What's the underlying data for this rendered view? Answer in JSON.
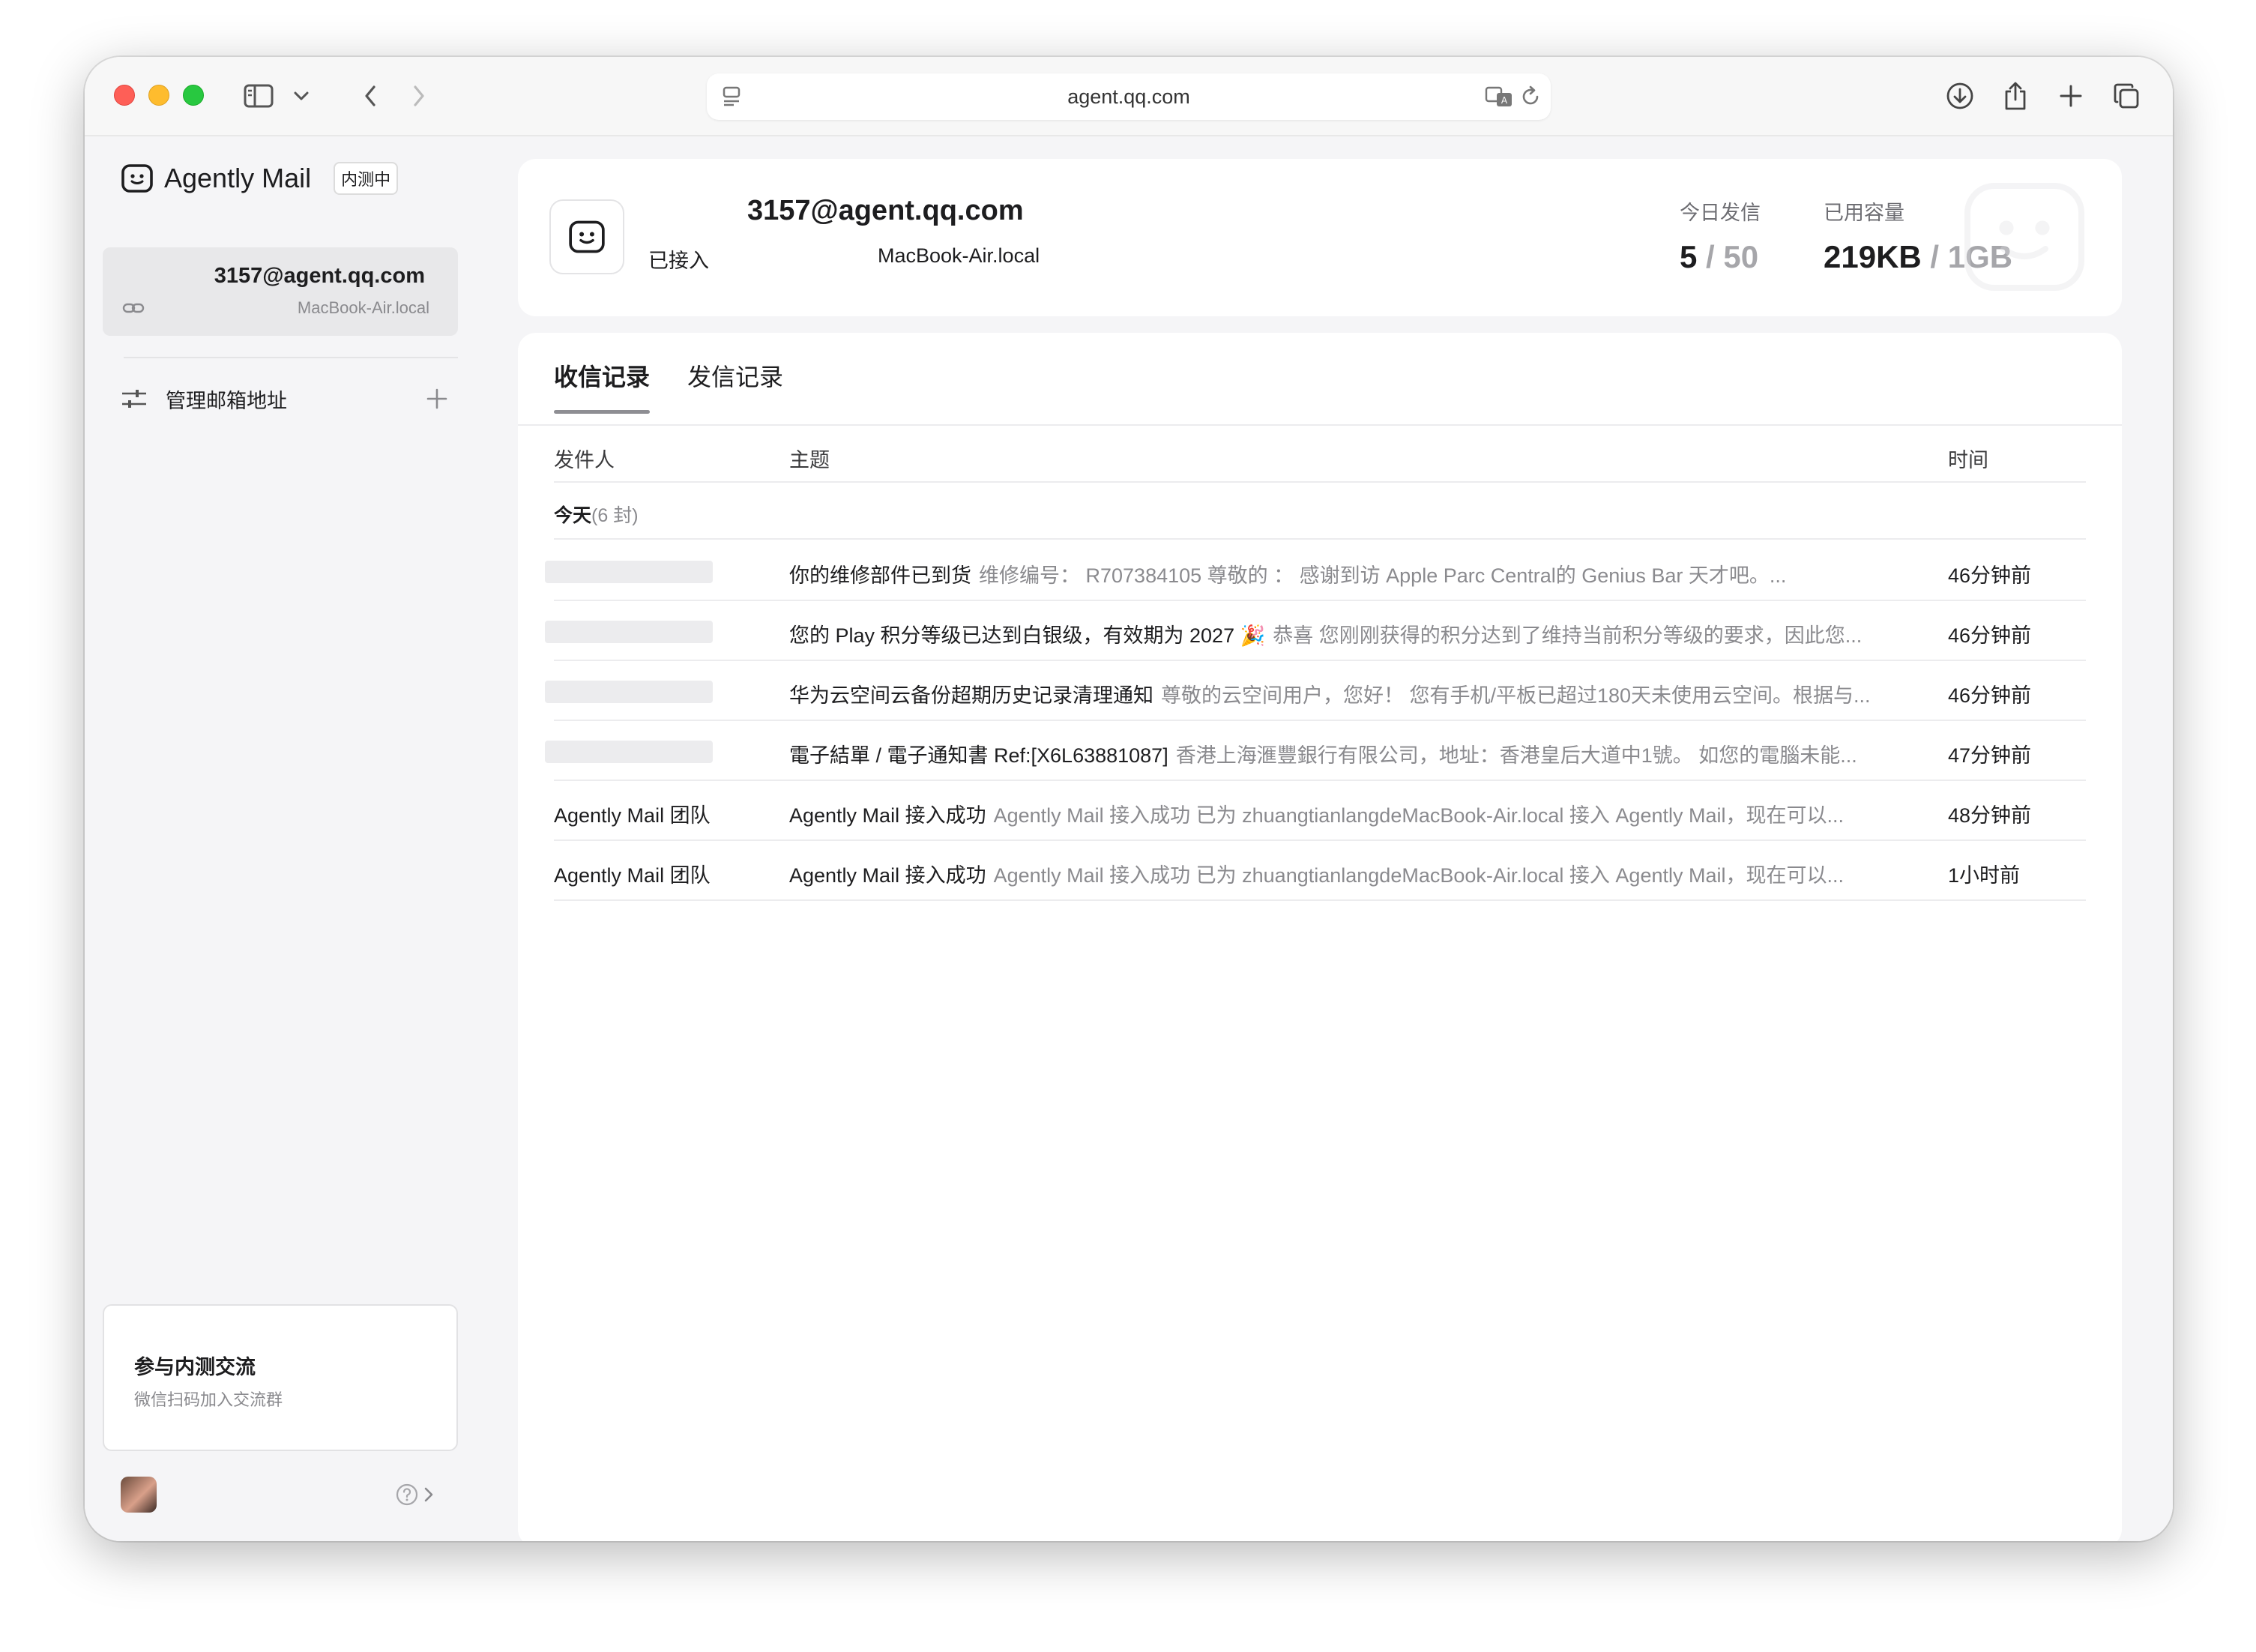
{
  "browser": {
    "url": "agent.qq.com"
  },
  "sidebar": {
    "brand": "Agently Mail",
    "beta_badge": "内测中",
    "mailbox_address": "3157@agent.qq.com",
    "mailbox_host": "MacBook-Air.local",
    "manage_label": "管理邮箱地址",
    "community_title": "参与内测交流",
    "community_subtitle": "微信扫码加入交流群"
  },
  "account": {
    "address": "3157@agent.qq.com",
    "status": "已接入",
    "host": "MacBook-Air.local",
    "sent_today_label": "今日发信",
    "sent_today_value": "5",
    "sent_today_limit": "/ 50",
    "storage_label": "已用容量",
    "storage_value": "219KB",
    "storage_limit": "/ 1GB"
  },
  "tabs": [
    {
      "label": "收信记录",
      "active": true
    },
    {
      "label": "发信记录",
      "active": false
    }
  ],
  "table": {
    "col_from": "发件人",
    "col_subject": "主题",
    "col_time": "时间",
    "group_label": "今天",
    "group_count": "(6 封)",
    "rows": [
      {
        "from": "",
        "subject": "你的维修部件已到货",
        "preview": "维修编号： R707384105 尊敬的 ：  感谢到访 Apple Parc Central的 Genius Bar 天才吧。...",
        "time": "46分钟前"
      },
      {
        "from": "",
        "subject": "您的 Play 积分等级已达到白银级，有效期为 2027 🎉",
        "preview": "恭喜 您刚刚获得的积分达到了维持当前积分等级的要求，因此您...",
        "time": "46分钟前"
      },
      {
        "from": "",
        "subject": "华为云空间云备份超期历史记录清理通知",
        "preview": "尊敬的云空间用户，您好！ 您有手机/平板已超过180天未使用云空间。根据与...",
        "time": "46分钟前"
      },
      {
        "from": "",
        "subject": "電子結單 / 電子通知書 Ref:[X6L63881087]",
        "preview": "香港上海滙豐銀行有限公司，地址：香港皇后大道中1號。 如您的電腦未能...",
        "time": "47分钟前"
      },
      {
        "from": "Agently Mail 团队",
        "subject": "Agently Mail 接入成功",
        "preview": "Agently Mail 接入成功 已为 zhuangtianlangdeMacBook-Air.local 接入 Agently Mail，现在可以...",
        "time": "48分钟前"
      },
      {
        "from": "Agently Mail 团队",
        "subject": "Agently Mail 接入成功",
        "preview": "Agently Mail 接入成功 已为 zhuangtianlangdeMacBook-Air.local 接入 Agently Mail，现在可以...",
        "time": "1小时前"
      }
    ]
  },
  "colors": {
    "accent": "#1d1d1f",
    "sidebar_bg": "#f5f5f7",
    "muted": "#8a8a8e"
  }
}
